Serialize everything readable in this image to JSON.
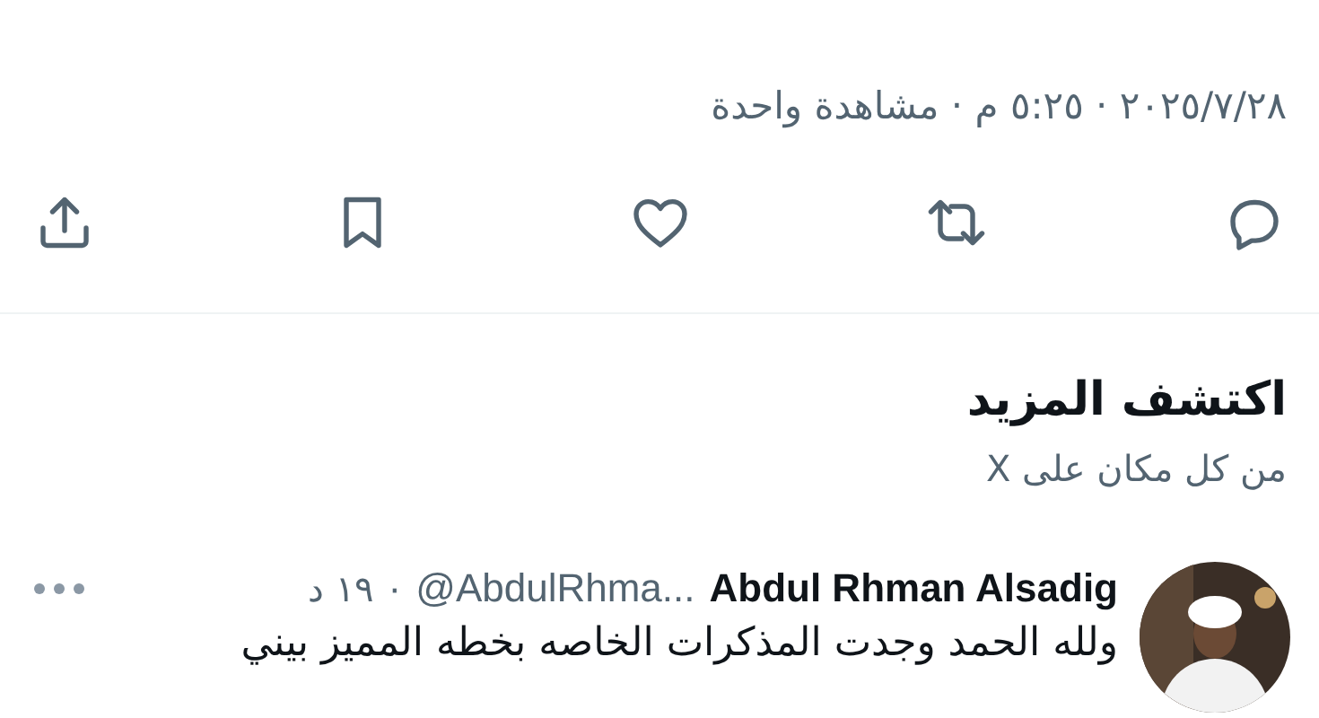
{
  "post_meta": "٢٠٢٥/٧/٢٨ · ٥:٢٥ م · مشاهدة واحدة",
  "actions": [
    {
      "kind": "reply"
    },
    {
      "kind": "repost"
    },
    {
      "kind": "like"
    },
    {
      "kind": "bookmark"
    },
    {
      "kind": "share"
    }
  ],
  "section": {
    "title": "اكتشف المزيد",
    "subtitle": "من كل مكان على X"
  },
  "posts": [
    {
      "name": "Abdul Rhman Alsadig",
      "handle": "@AbdulRhma...",
      "separator": "·",
      "time": "١٩ د",
      "text": "ولله الحمد وجدت المذكرات الخاصه بخطه المميز بيني"
    }
  ]
}
